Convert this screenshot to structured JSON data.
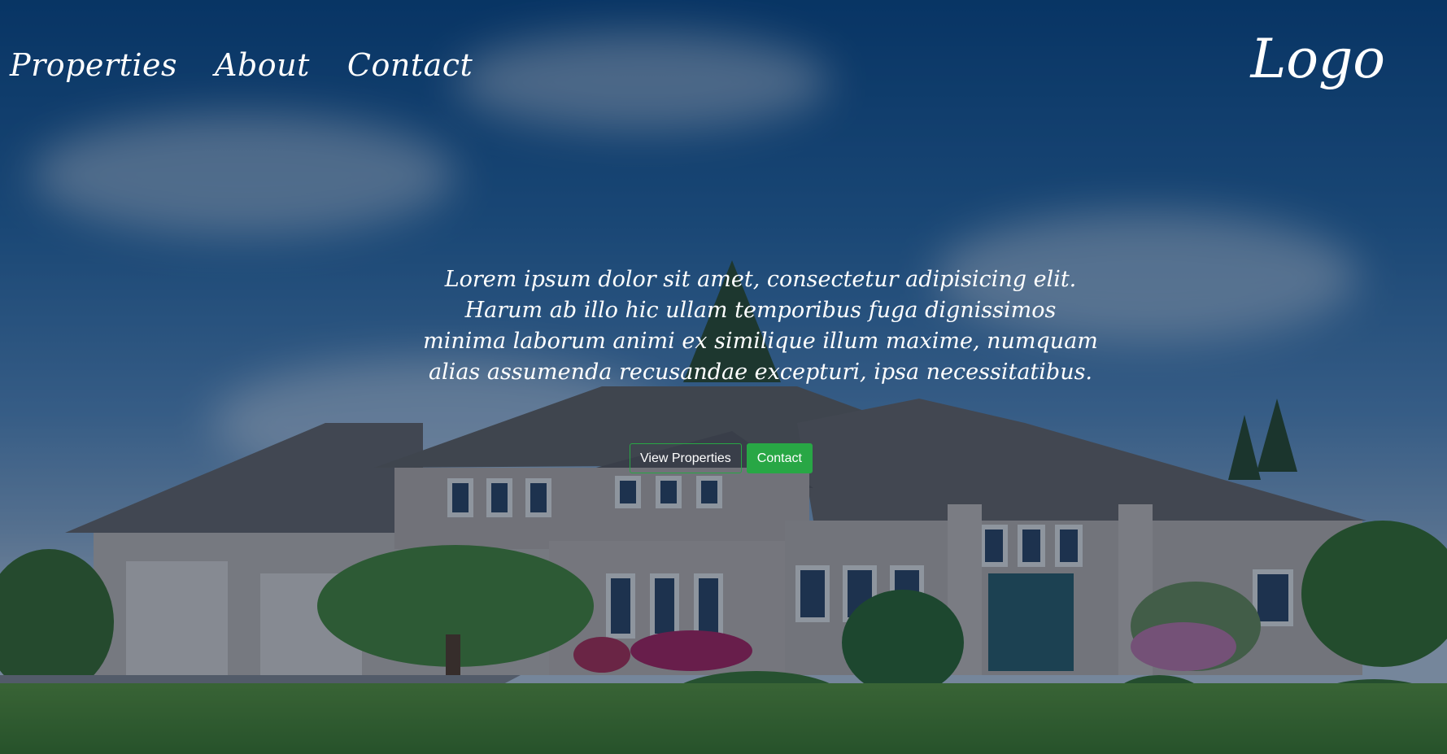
{
  "header": {
    "nav": [
      {
        "label": "Properties"
      },
      {
        "label": "About"
      },
      {
        "label": "Contact"
      }
    ],
    "logo": "Logo"
  },
  "hero": {
    "text": "Lorem ipsum dolor sit amet, consectetur adipisicing elit. Harum ab illo hic ullam temporibus fuga dignissimos minima laborum animi ex similique illum maxime, numquam alias assumenda recusandae excepturi, ipsa necessitatibus.",
    "buttons": {
      "view_properties": "View Properties",
      "contact": "Contact"
    }
  },
  "colors": {
    "accent": "#28a745",
    "text": "#ffffff"
  }
}
